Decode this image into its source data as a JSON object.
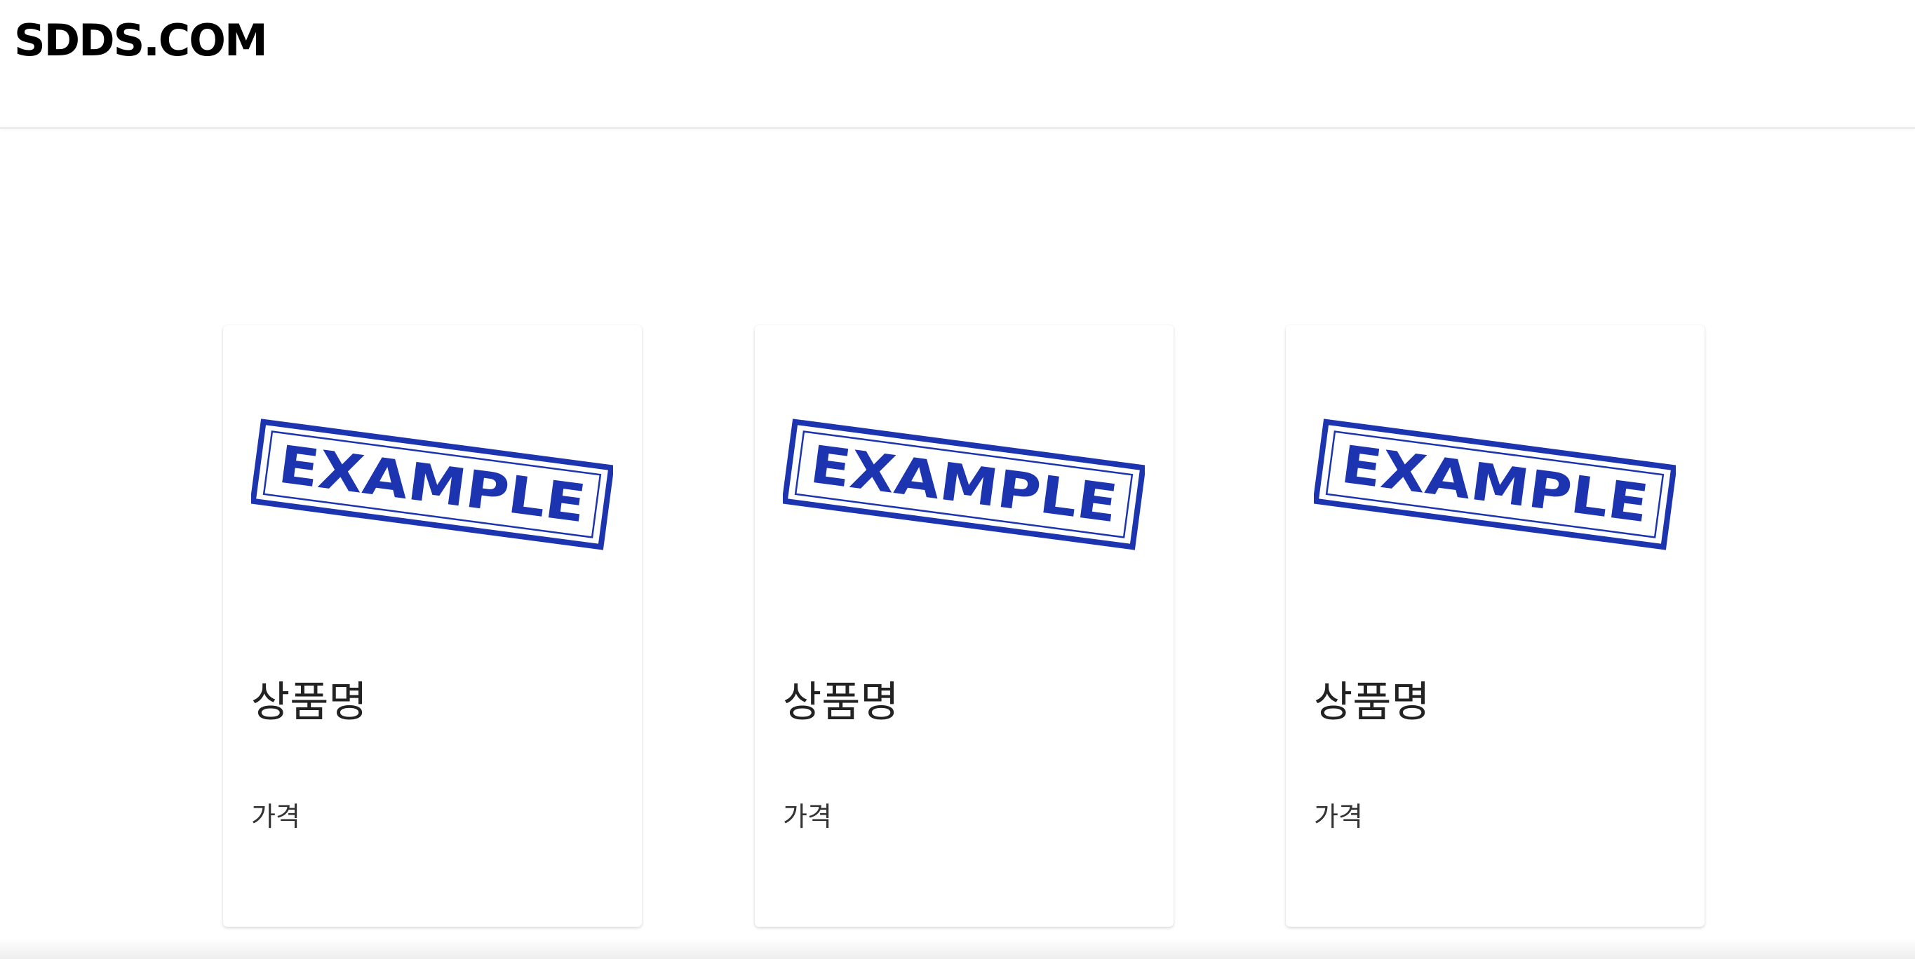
{
  "header": {
    "logo": "SDDS.COM"
  },
  "colors": {
    "stamp": "#1c34b0",
    "text": "#222222",
    "background": "#ffffff"
  },
  "products": [
    {
      "image_label": "EXAMPLE",
      "image_icon": "example-stamp-image",
      "name": "상품명",
      "price": "가격"
    },
    {
      "image_label": "EXAMPLE",
      "image_icon": "example-stamp-image",
      "name": "상품명",
      "price": "가격"
    },
    {
      "image_label": "EXAMPLE",
      "image_icon": "example-stamp-image",
      "name": "상품명",
      "price": "가격"
    }
  ]
}
